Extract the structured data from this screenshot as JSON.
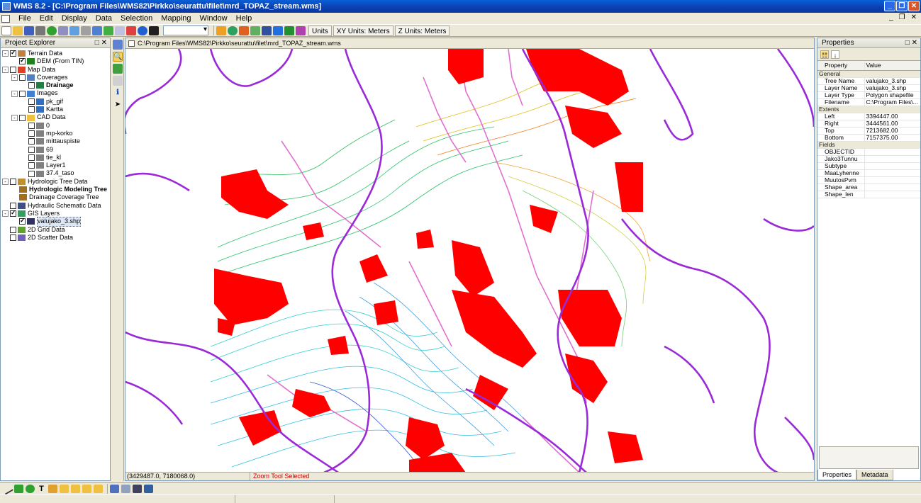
{
  "window": {
    "title": "WMS 8.2 - [C:\\Program Files\\WMS82\\Pirkko\\seurattu\\filet\\mrd_TOPAZ_stream.wms]"
  },
  "menu": [
    "File",
    "Edit",
    "Display",
    "Data",
    "Selection",
    "Mapping",
    "Window",
    "Help"
  ],
  "toolbar": {
    "units_label": "Units",
    "xy_units": "XY Units: Meters",
    "z_units": "Z Units: Meters"
  },
  "explorer": {
    "title": "Project Explorer",
    "nodes": [
      {
        "label": "Terrain Data",
        "level": 0,
        "exp": "-",
        "checked": true,
        "bold": false,
        "icon": "terrain-icon"
      },
      {
        "label": "DEM (From TIN)",
        "level": 1,
        "exp": "",
        "checked": true,
        "bold": false,
        "icon": "dem-icon"
      },
      {
        "label": "Map Data",
        "level": 0,
        "exp": "-",
        "checked": false,
        "bold": false,
        "icon": "map-icon"
      },
      {
        "label": "Coverages",
        "level": 1,
        "exp": "-",
        "checked": false,
        "bold": false,
        "icon": "coverages-icon"
      },
      {
        "label": "Drainage",
        "level": 2,
        "exp": "",
        "checked": false,
        "bold": true,
        "icon": "drainage-icon"
      },
      {
        "label": "Images",
        "level": 1,
        "exp": "-",
        "checked": false,
        "bold": false,
        "icon": "images-icon"
      },
      {
        "label": "pk_gif",
        "level": 2,
        "exp": "",
        "checked": false,
        "bold": false,
        "icon": "image-icon"
      },
      {
        "label": "Kartta",
        "level": 2,
        "exp": "",
        "checked": false,
        "bold": false,
        "icon": "image-icon"
      },
      {
        "label": "CAD Data",
        "level": 1,
        "exp": "-",
        "checked": false,
        "bold": false,
        "icon": "folder-icon"
      },
      {
        "label": "0",
        "level": 2,
        "exp": "",
        "checked": false,
        "bold": false,
        "icon": "cad-layer-icon"
      },
      {
        "label": "mp-korko",
        "level": 2,
        "exp": "",
        "checked": false,
        "bold": false,
        "icon": "cad-layer-icon"
      },
      {
        "label": "mittauspiste",
        "level": 2,
        "exp": "",
        "checked": false,
        "bold": false,
        "icon": "cad-layer-icon"
      },
      {
        "label": "69",
        "level": 2,
        "exp": "",
        "checked": false,
        "bold": false,
        "icon": "cad-layer-icon"
      },
      {
        "label": "tie_kl",
        "level": 2,
        "exp": "",
        "checked": false,
        "bold": false,
        "icon": "cad-layer-icon"
      },
      {
        "label": "Layer1",
        "level": 2,
        "exp": "",
        "checked": false,
        "bold": false,
        "icon": "cad-layer-icon"
      },
      {
        "label": "37.4_taso",
        "level": 2,
        "exp": "",
        "checked": false,
        "bold": false,
        "icon": "cad-layer-icon"
      },
      {
        "label": "Hydrologic Tree Data",
        "level": 0,
        "exp": "-",
        "checked": false,
        "bold": false,
        "icon": "hydro-icon"
      },
      {
        "label": "Hydrologic Modeling Tree",
        "level": 1,
        "exp": "",
        "checked": null,
        "bold": true,
        "icon": "tree-icon"
      },
      {
        "label": "Drainage Coverage Tree",
        "level": 1,
        "exp": "",
        "checked": null,
        "bold": false,
        "icon": "tree-icon"
      },
      {
        "label": "Hydraulic Schematic Data",
        "level": 0,
        "exp": "",
        "checked": false,
        "bold": false,
        "icon": "schematic-icon"
      },
      {
        "label": "GIS Layers",
        "level": 0,
        "exp": "-",
        "checked": true,
        "bold": false,
        "icon": "gis-icon"
      },
      {
        "label": "valujako_3.shp",
        "level": 1,
        "exp": "",
        "checked": true,
        "bold": false,
        "icon": "shapefile-icon",
        "selected": true
      },
      {
        "label": "2D Grid Data",
        "level": 0,
        "exp": "",
        "checked": false,
        "bold": false,
        "icon": "grid-icon"
      },
      {
        "label": "2D Scatter Data",
        "level": 0,
        "exp": "",
        "checked": false,
        "bold": false,
        "icon": "scatter-icon"
      }
    ]
  },
  "document": {
    "tab_title": "C:\\Program Files\\WMS82\\Pirkko\\seurattu\\filet\\mrd_TOPAZ_stream.wms",
    "coordinates": "(3429487.0, 7180068.0)",
    "status_message": "Zoom Tool Selected"
  },
  "properties": {
    "title": "Properties",
    "col_property": "Property",
    "col_value": "Value",
    "rows": [
      {
        "cat": "General"
      },
      {
        "k": "Tree Name",
        "v": "valujako_3.shp"
      },
      {
        "k": "Layer Name",
        "v": "valujako_3.shp"
      },
      {
        "k": "Layer Type",
        "v": "Polygon shapefile"
      },
      {
        "k": "Filename",
        "v": "C:\\Program Files\\..."
      },
      {
        "cat": "Extents"
      },
      {
        "k": "Left",
        "v": "3394447.00"
      },
      {
        "k": "Right",
        "v": "3444561.00"
      },
      {
        "k": "Top",
        "v": "7213682.00"
      },
      {
        "k": "Bottom",
        "v": "7157375.00"
      },
      {
        "cat": "Fields"
      },
      {
        "k": "OBJECTID",
        "v": ""
      },
      {
        "k": "Jako3Tunnu",
        "v": ""
      },
      {
        "k": "Subtype",
        "v": ""
      },
      {
        "k": "MaaLyhenne",
        "v": ""
      },
      {
        "k": "MuutosPvm",
        "v": ""
      },
      {
        "k": "Shape_area",
        "v": ""
      },
      {
        "k": "Shape_len",
        "v": ""
      }
    ],
    "tabs": [
      "Properties",
      "Metadata"
    ]
  },
  "colors": {
    "boundary": "#9a2ad8",
    "raster": "#ff0000",
    "stream": "#e070d0"
  }
}
